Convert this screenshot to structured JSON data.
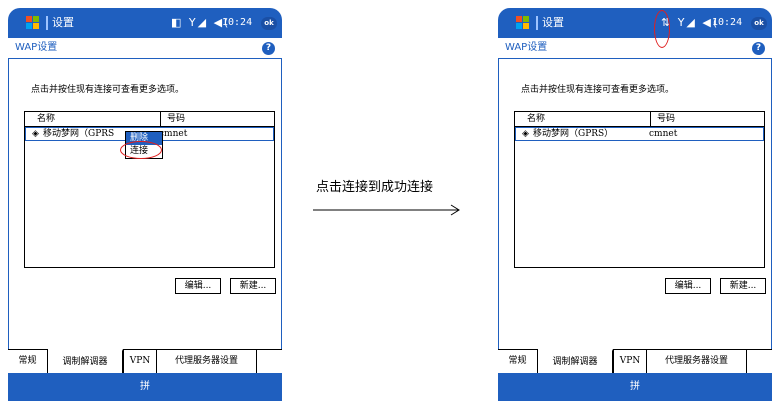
{
  "caption": "点击连接到成功连接",
  "phones": {
    "left": {
      "window_title": "设置",
      "status_icons": "◧ Y◢ ◀(",
      "time": "10:24",
      "ok_label": "ok",
      "page_title": "WAP设置",
      "help_label": "?",
      "info_text": "点击并按住现有连接可查看更多选项。",
      "list": {
        "columns": [
          "名称",
          "号码"
        ],
        "rows": [
          {
            "name": "移动梦网（GPRS",
            "number": "cmnet"
          }
        ]
      },
      "context_menu": [
        "删除",
        "连接"
      ],
      "buttons": {
        "edit": "编辑...",
        "new": "新建..."
      },
      "tabs": [
        "常规",
        "调制解调器",
        "VPN",
        "代理服务器设置"
      ],
      "active_tab": "调制解调器",
      "softkey": "拼"
    },
    "right": {
      "window_title": "设置",
      "status_icons": "⇅ Y◢ ◀(",
      "time": "10:24",
      "ok_label": "ok",
      "page_title": "WAP设置",
      "help_label": "?",
      "info_text": "点击并按住现有连接可查看更多选项。",
      "list": {
        "columns": [
          "名称",
          "号码"
        ],
        "rows": [
          {
            "name": "移动梦网（GPRS）",
            "number": "cmnet"
          }
        ]
      },
      "buttons": {
        "edit": "编辑...",
        "new": "新建..."
      },
      "tabs": [
        "常规",
        "调制解调器",
        "VPN",
        "代理服务器设置"
      ],
      "active_tab": "调制解调器",
      "softkey": "拼"
    }
  },
  "colors": {
    "accent": "#1f5fbf",
    "highlight": "#e02020"
  }
}
